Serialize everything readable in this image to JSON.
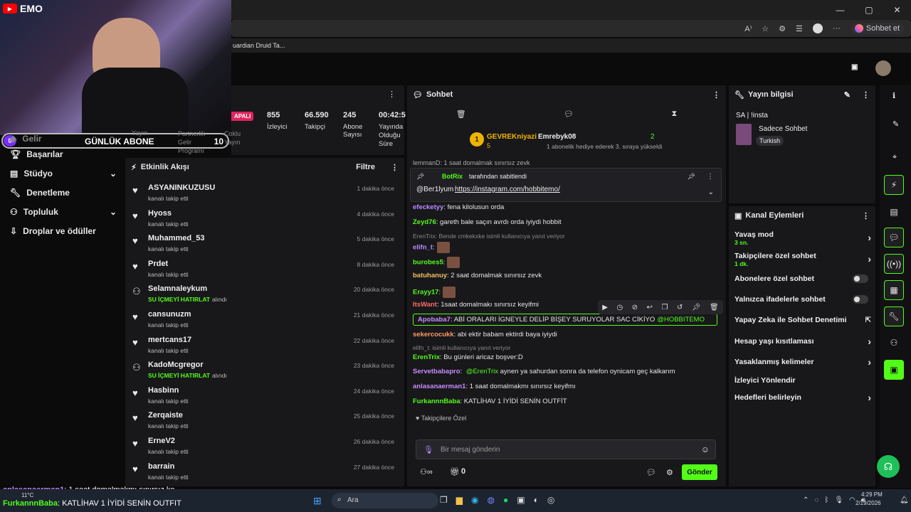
{
  "browser": {
    "tab_title": "uardian Druid Ta...",
    "address_icons": [
      "read-aloud-icon",
      "favorite-icon",
      "extensions-icon",
      "collections-icon",
      "profile-icon",
      "more-icon"
    ],
    "copilot": "Sohbet et",
    "window_controls": [
      "—",
      "▢",
      "✕"
    ]
  },
  "overlay": {
    "yt_label": "EMO",
    "goal_label": "GÜNLÜK ABONE",
    "goal_current": "0",
    "goal_target": "10"
  },
  "sidebar": {
    "items": [
      {
        "label": "Gelir"
      },
      {
        "label": "Başarılar"
      },
      {
        "label": "Stüdyo"
      },
      {
        "label": "Denetleme"
      },
      {
        "label": "Topluluk"
      },
      {
        "label": "Droplar ve ödüller"
      }
    ]
  },
  "stats": {
    "status": "APALI",
    "items": [
      {
        "value": "855",
        "label": "İzleyici"
      },
      {
        "value": "66.590",
        "label": "Takipçi"
      },
      {
        "value": "245",
        "label": "Abone Sayısı"
      },
      {
        "value": "00:42:5",
        "label": "Yayında Olduğu Süre"
      }
    ],
    "partial_labels": [
      "Yayın",
      "Partnerlik Gelir Programı",
      "Çoklu Yayın"
    ]
  },
  "activity": {
    "title": "Etkinlik Akışı",
    "filter": "Filtre",
    "events": [
      {
        "name": "ASYANINKUZUSU",
        "sub": "kanalı takip etti",
        "time": "1 dakika önce",
        "type": "follow"
      },
      {
        "name": "Hyoss",
        "sub": "kanalı takip etti",
        "time": "4 dakika önce",
        "type": "follow"
      },
      {
        "name": "Muhammed_53",
        "sub": "kanalı takip etti",
        "time": "5 dakika önce",
        "type": "follow"
      },
      {
        "name": "Prdet",
        "sub": "kanalı takip etti",
        "time": "8 dakika önce",
        "type": "follow"
      },
      {
        "name": "Selamnaleykum",
        "sub_hl": "SU İÇMEYİ HATIRLAT",
        "sub": "alındı",
        "time": "20 dakika önce",
        "type": "reward"
      },
      {
        "name": "cansunuzm",
        "sub": "kanalı takip etti",
        "time": "21 dakika önce",
        "type": "follow"
      },
      {
        "name": "mertcans17",
        "sub": "kanalı takip etti",
        "time": "22 dakika önce",
        "type": "follow"
      },
      {
        "name": "KadoMcgregor",
        "sub_hl": "SU İÇMEYİ HATIRLAT",
        "sub": "alındı",
        "time": "23 dakika önce",
        "type": "reward"
      },
      {
        "name": "Hasbinn",
        "sub": "kanalı takip etti",
        "time": "24 dakika önce",
        "type": "follow"
      },
      {
        "name": "Zerqaiste",
        "sub": "kanalı takip etti",
        "time": "25 dakika önce",
        "type": "follow"
      },
      {
        "name": "ErneV2",
        "sub": "kanalı takip etti",
        "time": "26 dakika önce",
        "type": "follow"
      },
      {
        "name": "barrain",
        "sub": "kanalı takip etti",
        "time": "27 dakika önce",
        "type": "follow"
      }
    ]
  },
  "chat": {
    "title": "Sohbet",
    "leader1": {
      "name": "GEVREKniyazi",
      "count": "5",
      "rank": "1"
    },
    "leader2": {
      "name": "Emrebyk08",
      "count": "2",
      "note": "1 abonelik hediye ederek 3. sıraya yükseldi"
    },
    "partial_top": "lemmanD: 1 saat domalmak sınırsız zevk",
    "pinned": {
      "by": "BotRix",
      "by_suffix": "tarafından sabitlendi",
      "user": "@Ber1lyum",
      "link": "https://instagram.com/hobbitemo/"
    },
    "messages": [
      {
        "user": "efecketyy",
        "text": ": fena kilolusun orda",
        "color": "#b98cff"
      },
      {
        "user": "Zeyd76",
        "text": ": gareth bale saçın avrdı orda iyiydi hobbit",
        "color": "#53fc18"
      },
      {
        "reply": "ErenTrix: Bende cmkekxke isimli kullanıcıya yanıt veriyor"
      },
      {
        "user": "elifn_t",
        "text": ":",
        "color": "#b98cff"
      },
      {
        "user": "burobes5",
        "text": ":",
        "color": "#53fc18"
      },
      {
        "user": "batuhanuy",
        "text": ": 2 saat domalmak sınırsız zevk",
        "color": "#f0c060"
      },
      {
        "user": "Erayy17",
        "text": ":",
        "color": "#53fc18"
      },
      {
        "user": "ItsWant",
        "text": ": 1saat domalmakı sınırsız keyifmi",
        "color": "#ff6a6a"
      },
      {
        "user": "Apobaba7",
        "text": ": ABİ ORALARI İGNEYLE DELİP BİŞEY SURUYOLAR SAC CİKİYO",
        "mention": "@HOBBITEMO",
        "color": "#c98cff"
      },
      {
        "user": "sekercocukk",
        "text": ": abi ektir babam ektirdi baya iyiydi",
        "color": "#ff9a6a"
      },
      {
        "reply": "elifn_t:  isimli kullanıcıya yanıt veriyor"
      },
      {
        "user": "ErenTrix",
        "text": ": Bu günleri aricaz boşver:D",
        "color": "#53fc18"
      },
      {
        "user": "Servetbabapro",
        "text": ": ",
        "mention": "@ErenTrix",
        "text2": " aynen ya sahurdan sonra da telefon oynicam geç kalkarım",
        "color": "#c98cff"
      },
      {
        "user": "anlasanaerman1",
        "text": ": 1 saat domalmakmı sınırsız keyifmı",
        "color": "#c98cff"
      },
      {
        "user": "FurkannnBaba",
        "text": ": KATLİHAV 1 İYİDİ SENİN OUTFİT",
        "color": "#53fc18"
      }
    ],
    "mode_label": "Takipçilere Özel",
    "input_placeholder": "Bir mesaj gönderin",
    "points": "0",
    "send": "Gönder"
  },
  "info": {
    "title": "Yayın bilgisi",
    "stream_title": "SA | !insta",
    "category": "Sadece Sohbet",
    "language": "Turkish"
  },
  "channel": {
    "title": "Kanal Eylemleri",
    "items": [
      {
        "label": "Yavaş mod",
        "sub": "3 sn.",
        "kind": "chev"
      },
      {
        "label": "Takipçilere özel sohbet",
        "sub": "1 dk.",
        "kind": "chev"
      },
      {
        "label": "Abonelere özel sohbet",
        "kind": "toggle"
      },
      {
        "label": "Yalnızca ifadelerle sohbet",
        "kind": "toggle"
      },
      {
        "label": "Yapay Zeka ile Sohbet Denetimi",
        "kind": "ext"
      },
      {
        "label": "Hesap yaşı kısıtlaması",
        "kind": "chev"
      },
      {
        "label": "Yasaklanmış kelimeler",
        "kind": "chev"
      },
      {
        "label": "İzleyici Yönlendir",
        "kind": "none"
      },
      {
        "label": "Hedefleri belirleyin",
        "kind": "chev"
      }
    ]
  },
  "overlay_chat": [
    {
      "user": "anlasanaerman1",
      "text": ": 1 saat domalmakmı sınırsız ke"
    },
    {
      "user": "FurkannnBaba",
      "text": ": KATLİHAV 1 İYİDİ SENİN OUTFIT"
    }
  ],
  "taskbar": {
    "weather": "11°C",
    "search": "Ara",
    "time": "4:29 PM",
    "date": "2/19/2026"
  }
}
